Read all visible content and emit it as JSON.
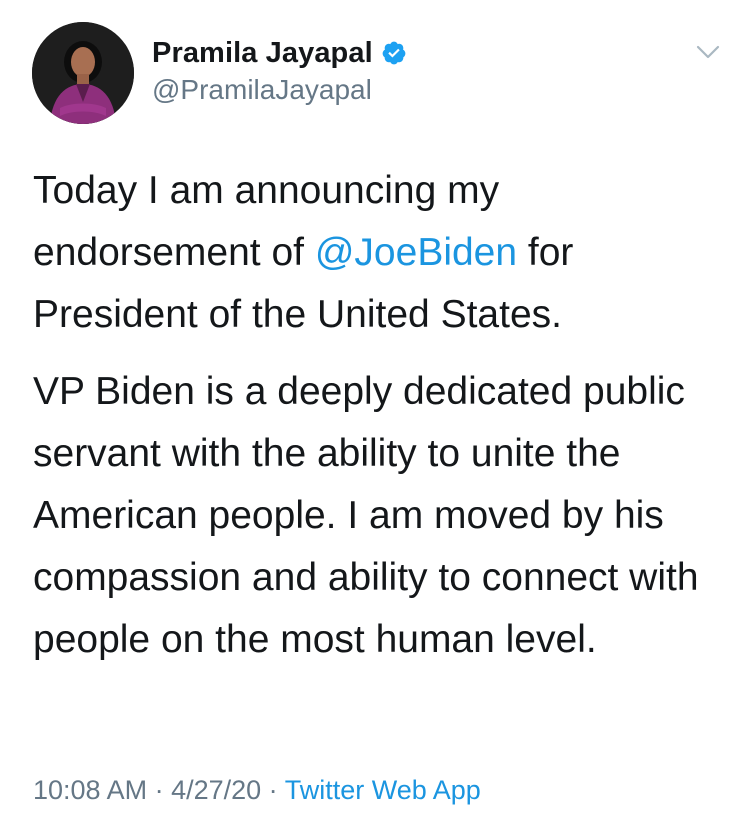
{
  "author": {
    "display_name": "Pramila Jayapal",
    "handle": "@PramilaJayapal",
    "verified": true,
    "avatar_icon": "profile-photo"
  },
  "tweet": {
    "para1_before": "Today I am announcing my endorsement of ",
    "para1_mention": "@JoeBiden",
    "para1_after": " for President of the United States.",
    "para2": "VP Biden is a deeply dedicated public servant with the ability to unite the American people. I am moved by his compassion and ability to connect with people on the most human level."
  },
  "meta": {
    "time": "10:08 AM",
    "separator": " · ",
    "date": "4/27/20",
    "source": "Twitter Web App"
  },
  "colors": {
    "link": "#1b95e0",
    "secondary_text": "#657786",
    "primary_text": "#14171a",
    "verified_badge": "#1da1f2"
  },
  "icons": {
    "verified": "verified-badge-icon",
    "menu": "chevron-down-icon"
  }
}
